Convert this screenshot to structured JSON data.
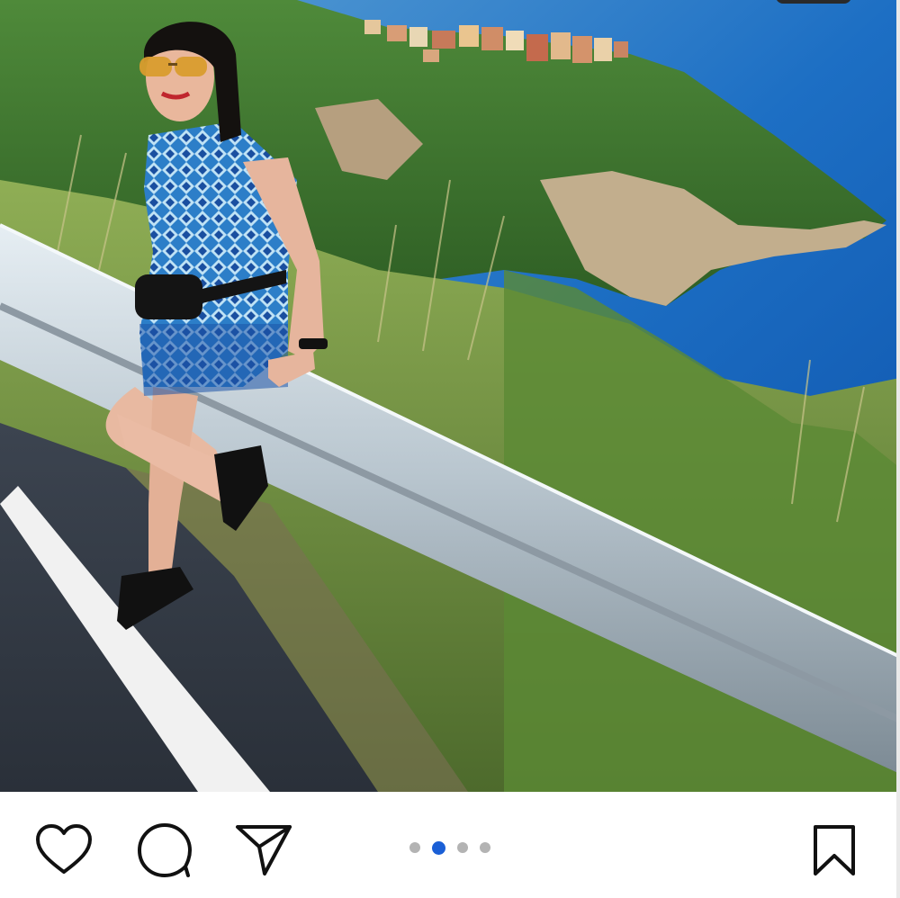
{
  "post": {
    "image": {
      "alt": "",
      "scene": "woman-on-guardrail-coastal-village"
    },
    "carousel": {
      "total": 4,
      "active_index": 1
    },
    "actions": {
      "like_icon": "heart-icon",
      "comment_icon": "comment-bubble-icon",
      "share_icon": "paper-plane-icon",
      "save_icon": "bookmark-icon"
    },
    "colors": {
      "icon_stroke": "#111111",
      "active_dot": "#1a5fd6",
      "inactive_dot": "#b3b3b3"
    }
  }
}
